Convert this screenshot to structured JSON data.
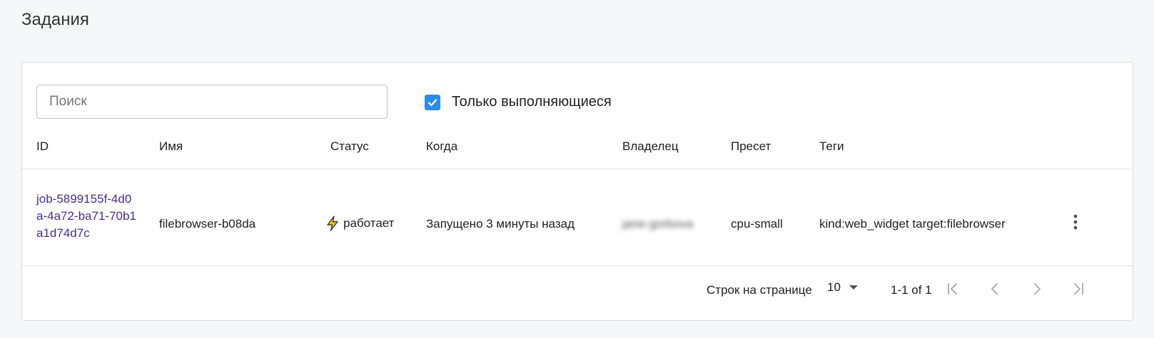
{
  "page": {
    "title": "Задания"
  },
  "filters": {
    "search_placeholder": "Поиск",
    "search_value": "",
    "running_only_label": "Только выполняющиеся",
    "running_only_checked": true,
    "accent_color": "#2b8ee6"
  },
  "table": {
    "columns": [
      "ID",
      "Имя",
      "Статус",
      "Когда",
      "Владелец",
      "Пресет",
      "Теги"
    ],
    "rows": [
      {
        "id": "job-5899155f-4d0a-4a72-ba71-70b1a1d74d7c",
        "name": "filebrowser-b08da",
        "status": "работает",
        "status_icon": "lightning-icon",
        "when": "Запущено 3 минуты назад",
        "owner": "jane-gorbova",
        "preset": "cpu-small",
        "tags": "kind:web_widget target:filebrowser"
      }
    ]
  },
  "pagination": {
    "rows_per_page_label": "Строк на странице",
    "rows_per_page_value": "10",
    "range": "1-1 of 1"
  }
}
